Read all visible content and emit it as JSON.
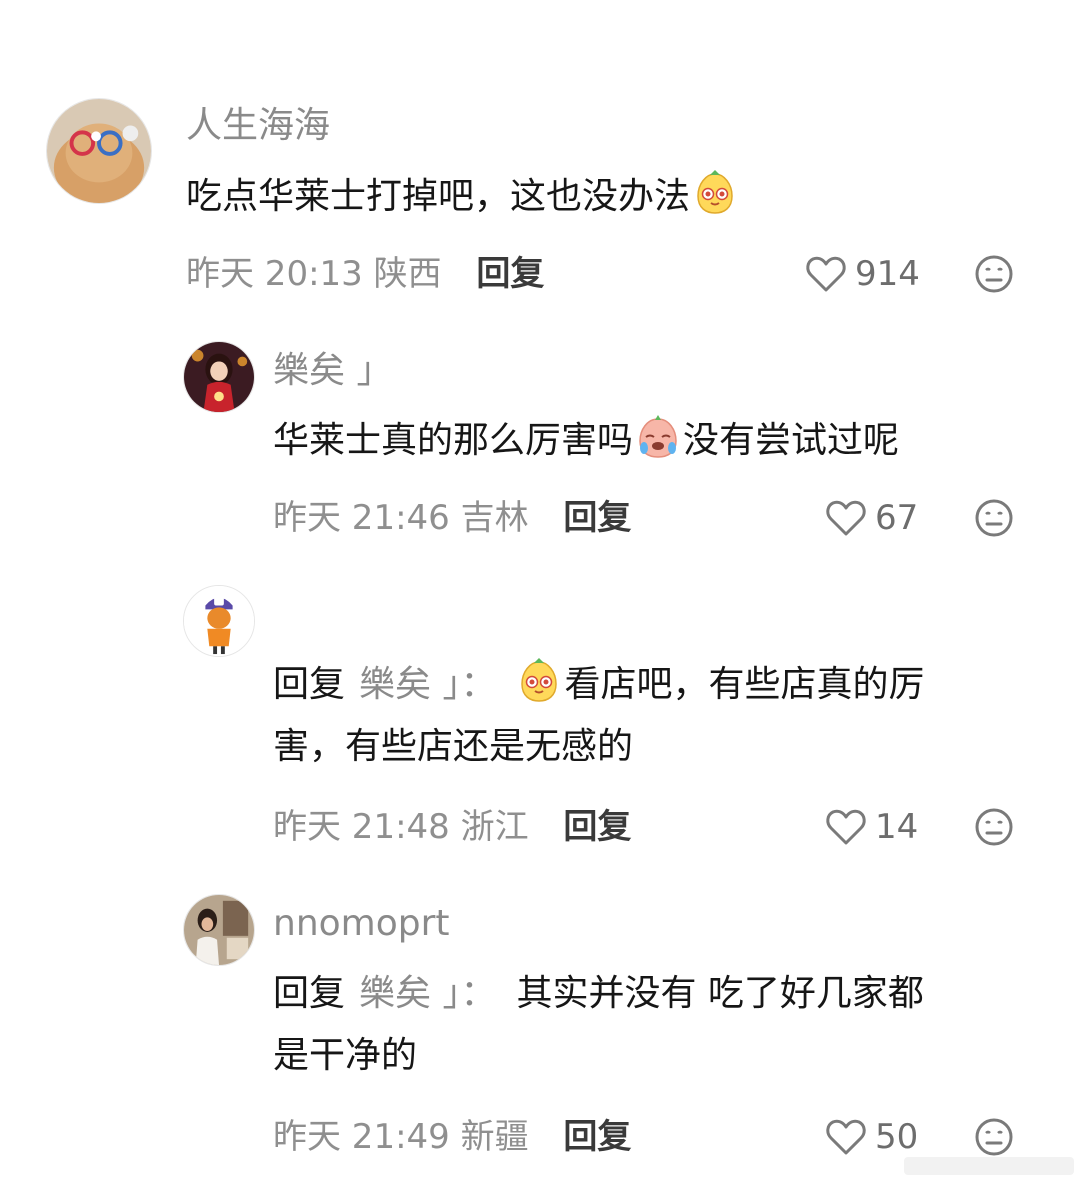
{
  "comments": [
    {
      "username": "人生海海",
      "text_before": "吃点华莱士打掉吧，这也没办法",
      "emoji_after": "mango-face-emoji",
      "time": "昨天 20:13 陕西",
      "reply_label": "回复",
      "likes": "914"
    },
    {
      "username": "樂矣 」",
      "text_before": "华莱士真的那么厉害吗",
      "emoji_mid": "crying-peach-emoji",
      "text_after": "没有尝试过呢",
      "time": "昨天 21:46 吉林",
      "reply_label": "回复",
      "likes": "67"
    },
    {
      "username": "",
      "reply_prefix": "回复",
      "reply_target": "樂矣 」：",
      "emoji_mid": "mango-face-emoji",
      "text_line1": "看店吧，有些店真的厉",
      "text_line2": "害，有些店还是无感的",
      "time": "昨天 21:48 浙江",
      "reply_label": "回复",
      "likes": "14"
    },
    {
      "username": "nnomoprt",
      "reply_prefix": "回复",
      "reply_target": "樂矣 」：",
      "text_line1": "其实并没有 吃了好几家都",
      "text_line2": "是干净的",
      "time": "昨天 21:49 新疆",
      "reply_label": "回复",
      "likes": "50"
    }
  ],
  "icons": {
    "like": "heart-outline-icon",
    "dislike": "meh-face-icon"
  },
  "colors": {
    "text": "#161616",
    "muted": "#8a8a8a",
    "icon": "#7a7a7a"
  }
}
